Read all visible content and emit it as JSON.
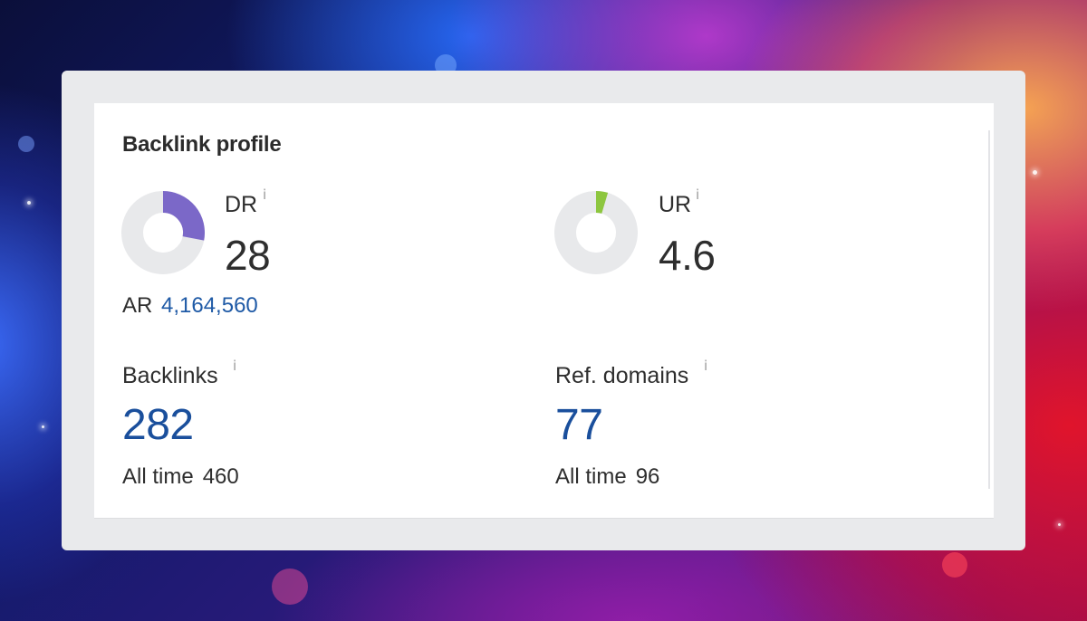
{
  "card": {
    "title": "Backlink profile"
  },
  "dr": {
    "label": "DR",
    "info_icon": "i",
    "value": "28",
    "ring_fraction": 0.28,
    "ring_color": "#7b68c8",
    "ring_track_color": "#e8e9eb"
  },
  "ur": {
    "label": "UR",
    "info_icon": "i",
    "value": "4.6",
    "ring_fraction": 0.046,
    "ring_color": "#8dc63f",
    "ring_track_color": "#e8e9eb"
  },
  "ar": {
    "label": "AR",
    "value": "4,164,560"
  },
  "backlinks": {
    "label": "Backlinks",
    "info_icon": "i",
    "value": "282",
    "alltime_label": "All time",
    "alltime_value": "460"
  },
  "ref_domains": {
    "label": "Ref. domains",
    "info_icon": "i",
    "value": "77",
    "alltime_label": "All time",
    "alltime_value": "96"
  },
  "colors": {
    "link_blue": "#1f5aa6",
    "big_number_blue": "#1a4f9c",
    "text": "#2e2e2e"
  }
}
